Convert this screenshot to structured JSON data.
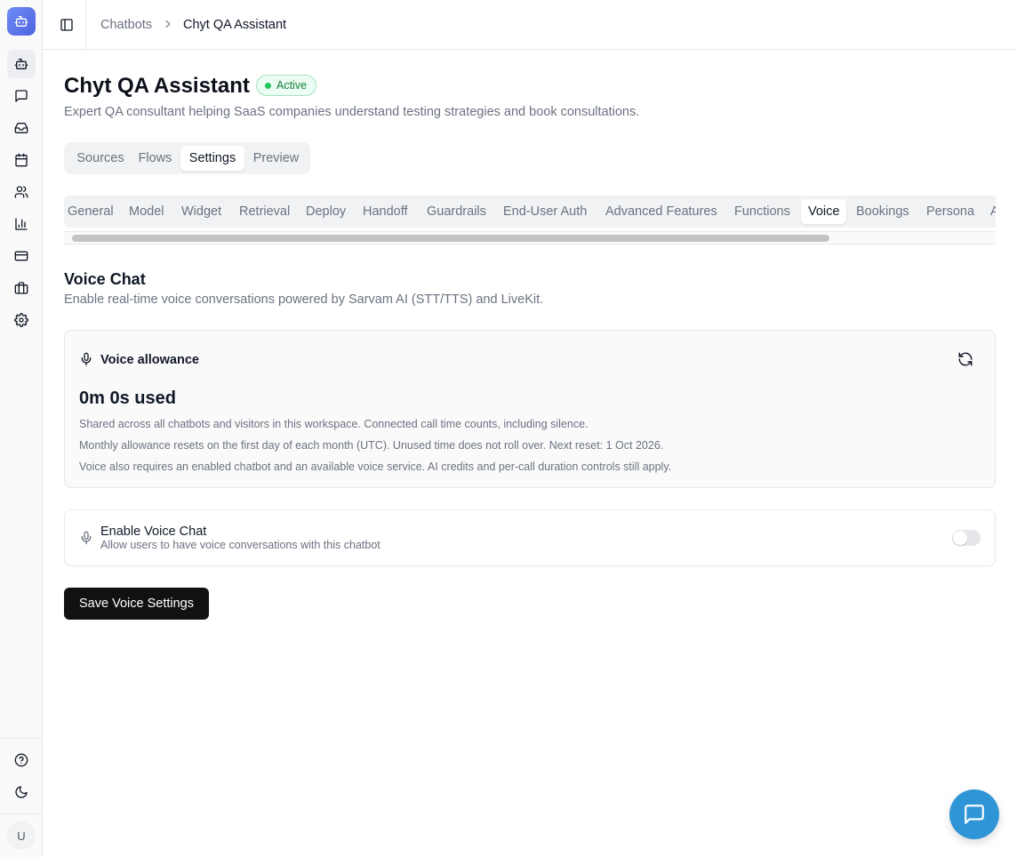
{
  "breadcrumb": {
    "root": "Chatbots",
    "current": "Chyt QA Assistant"
  },
  "page": {
    "title": "Chyt QA Assistant",
    "status": "Active",
    "description": "Expert QA consultant helping SaaS companies understand testing strategies and book consultations."
  },
  "segments": [
    "Sources",
    "Flows",
    "Settings",
    "Preview"
  ],
  "segment_selected": "Settings",
  "tabs": [
    "General",
    "Model",
    "Widget",
    "Retrieval",
    "Deploy",
    "Handoff",
    "Guardrails",
    "End-User Auth",
    "Advanced Features",
    "Functions",
    "Voice",
    "Bookings",
    "Persona",
    "A"
  ],
  "tab_selected": "Voice",
  "section": {
    "title": "Voice Chat",
    "description": "Enable real-time voice conversations powered by Sarvam AI (STT/TTS) and LiveKit."
  },
  "allowance": {
    "title": "Voice allowance",
    "used": "0m 0s used",
    "notes": [
      "Shared across all chatbots and visitors in this workspace. Connected call time counts, including silence.",
      "Monthly allowance resets on the first day of each month (UTC). Unused time does not roll over. Next reset: 1 Oct 2026.",
      "Voice also requires an enabled chatbot and an available voice service. AI credits and per-call duration controls still apply."
    ]
  },
  "enable_voice": {
    "title": "Enable Voice Chat",
    "description": "Allow users to have voice conversations with this chatbot",
    "enabled": false
  },
  "save_button": "Save Voice Settings",
  "user_initial": "U",
  "colors": {
    "accent": "#111111",
    "brand": "#4f63e0",
    "active_badge": "#15803d",
    "chat_fab": "#2f95d6"
  }
}
